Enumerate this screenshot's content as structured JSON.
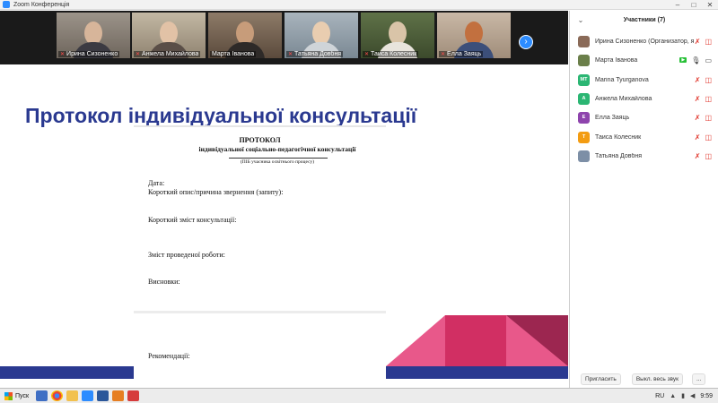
{
  "window": {
    "title": "Zoom Конференція",
    "buttons": [
      "–",
      "□",
      "✕"
    ]
  },
  "gallery": {
    "tiles": [
      {
        "name": "Ирина Сизоненко",
        "muted": true
      },
      {
        "name": "Анжела Михайлова",
        "muted": true
      },
      {
        "name": "Марта Іванова",
        "muted": false
      },
      {
        "name": "Татьяна Довбня",
        "muted": true
      },
      {
        "name": "Таиса Колесник",
        "muted": true
      },
      {
        "name": "Елла Заяць",
        "muted": true
      }
    ],
    "next_icon": "chevron-right-icon"
  },
  "slide": {
    "title": "Протокол індивідуальної консультації",
    "doc": {
      "title": "ПРОТОКОЛ",
      "subtitle": "індивідуальної соціально-педагогічної консультації",
      "hint": "(ПІБ учасника освітнього процесу)",
      "fields": [
        "Дата:",
        "Короткий опис/причина звернення (запиту):",
        "Короткий зміст консультації:",
        "Зміст проведеної роботи:",
        "Висновки:",
        "Рекомендації:"
      ]
    },
    "colors": {
      "title": "#2a3990",
      "band": "#2a3990",
      "pink": "#e8588a",
      "crimson": "#d12f63",
      "maroon": "#9c2650"
    }
  },
  "participants": {
    "title": "Участники (7)",
    "items": [
      {
        "name": "Ирина Сизоненко (Организатор, я)",
        "initials": "",
        "color": "#8a6a58",
        "mic": "muted",
        "cam": "muted",
        "share": false
      },
      {
        "name": "Марта Іванова",
        "initials": "",
        "color": "#6b7f4a",
        "mic": "on",
        "cam": "none",
        "share": true
      },
      {
        "name": "Marina Tyurganova",
        "initials": "MT",
        "color": "#2bb673",
        "mic": "muted",
        "cam": "muted",
        "share": false
      },
      {
        "name": "Анжела Михайлова",
        "initials": "A",
        "color": "#2bb673",
        "mic": "muted",
        "cam": "muted",
        "share": false
      },
      {
        "name": "Елла Заяць",
        "initials": "E",
        "color": "#8e44ad",
        "mic": "muted",
        "cam": "muted",
        "share": false
      },
      {
        "name": "Таиса Колесник",
        "initials": "T",
        "color": "#f39c12",
        "mic": "muted",
        "cam": "muted",
        "share": false
      },
      {
        "name": "Татьяна Довбня",
        "initials": "",
        "color": "#7d8fa6",
        "mic": "muted",
        "cam": "muted",
        "share": false
      }
    ],
    "footer": {
      "invite": "Пригласить",
      "mute_all": "Выкл. весь звук",
      "more": "..."
    }
  },
  "taskbar": {
    "start_label": "Пуск",
    "apps": [
      "save-icon",
      "chrome-icon",
      "explorer-icon",
      "zoom-icon",
      "word-icon",
      "player-icon",
      "pdf-icon"
    ],
    "lang": "RU",
    "clock": "9:59"
  }
}
